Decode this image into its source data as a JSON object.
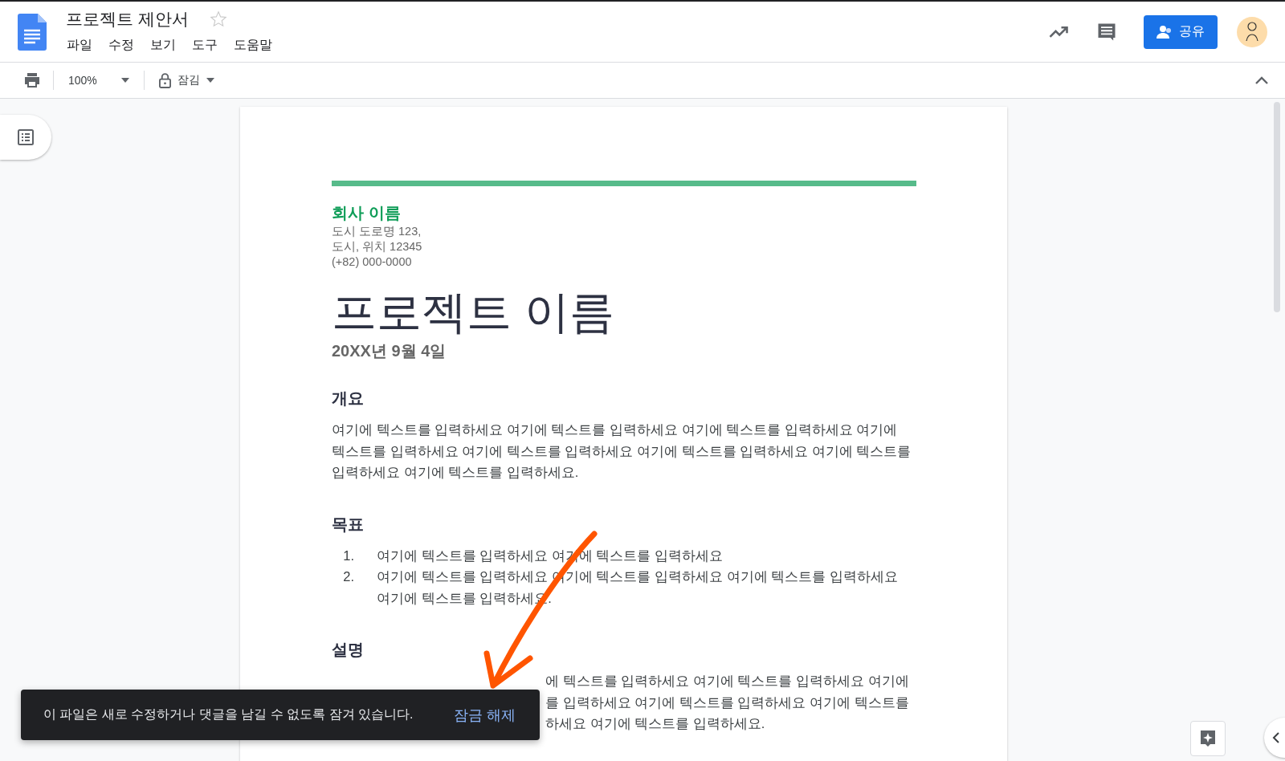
{
  "document": {
    "title": "프로젝트 제안서",
    "starred": false
  },
  "menu": [
    "파일",
    "수정",
    "보기",
    "도구",
    "도움말"
  ],
  "toolbar": {
    "zoom": "100%",
    "mode": "잠김"
  },
  "share_button": "공유",
  "page": {
    "company": "회사 이름",
    "address": [
      "도시 도로명 123,",
      "도시, 위치 12345",
      "(+82) 000-0000"
    ],
    "project_title": "프로젝트 이름",
    "date": "20XX년 9월 4일",
    "sections": [
      {
        "heading": "개요",
        "kind": "paragraph",
        "text": "여기에 텍스트를 입력하세요 여기에 텍스트를 입력하세요 여기에 텍스트를 입력하세요 여기에 텍스트를 입력하세요 여기에 텍스트를 입력하세요 여기에 텍스트를 입력하세요 여기에 텍스트를 입력하세요 여기에 텍스트를 입력하세요."
      },
      {
        "heading": "목표",
        "kind": "list",
        "items": [
          {
            "number": "1.",
            "text": "여기에 텍스트를 입력하세요 여기에 텍스트를 입력하세요"
          },
          {
            "number": "2.",
            "text": "여기에 텍스트를 입력하세요 여기에 텍스트를 입력하세요 여기에 텍스트를 입력하세요 여기에 텍스트를 입력하세요."
          }
        ]
      },
      {
        "heading": "설명",
        "kind": "covered",
        "lines": [
          "에 텍스트를 입력하세요 여기에 텍스트를 입력하세요 여기에",
          "를 입력하세요 여기에 텍스트를 입력하세요 여기에 텍스트를",
          "하세요 여기에 텍스트를 입력하세요."
        ]
      }
    ]
  },
  "toast": {
    "message": "이 파일은 새로 수정하거나 댓글을 남길 수 없도록 잠겨 있습니다.",
    "action": "잠금 해제"
  }
}
